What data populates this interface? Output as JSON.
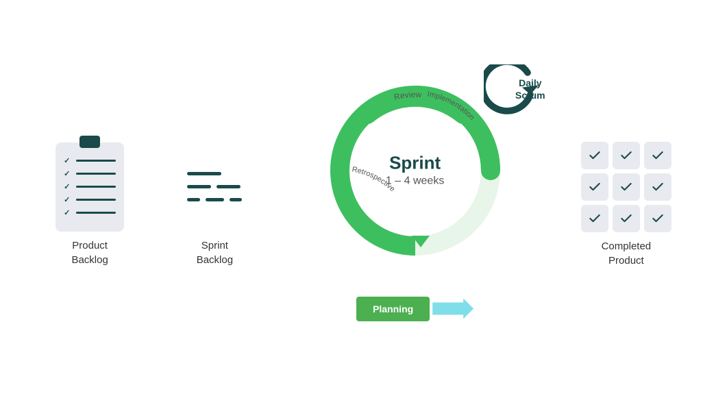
{
  "product_backlog": {
    "label": "Product\nBacklog",
    "label_line1": "Product",
    "label_line2": "Backlog"
  },
  "sprint_backlog": {
    "label_line1": "Sprint",
    "label_line2": "Backlog"
  },
  "sprint": {
    "title": "Sprint",
    "weeks": "1 – 4 weeks",
    "arc_labels": {
      "review": "Review",
      "implementation": "Implementation",
      "retrospective": "Retrospective"
    }
  },
  "daily_scrum": {
    "line1": "Daily",
    "line2": "Scrum"
  },
  "planning": {
    "label": "Planning"
  },
  "completed_product": {
    "label_line1": "Completed",
    "label_line2": "Product"
  },
  "colors": {
    "green": "#3dbf5f",
    "dark_teal": "#1a4a4a",
    "light_blue": "#80deea",
    "bg_tile": "#e8eaf0"
  }
}
